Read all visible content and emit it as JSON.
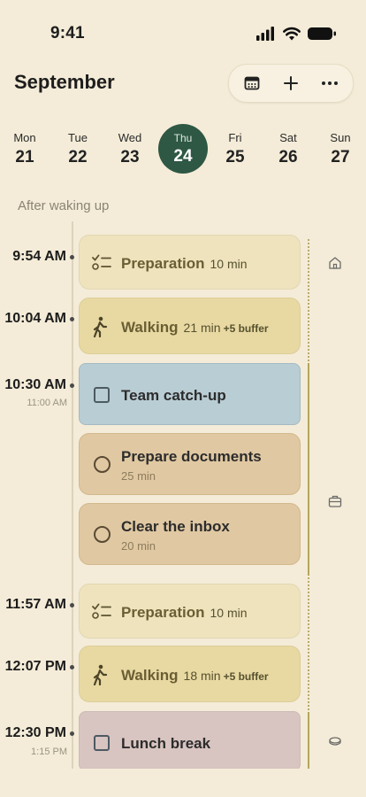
{
  "status_bar": {
    "time": "9:41",
    "icons": [
      "signal-icon",
      "wifi-icon",
      "battery-icon"
    ]
  },
  "header": {
    "month": "September",
    "actions": [
      {
        "name": "calendar-icon"
      },
      {
        "name": "add-icon"
      },
      {
        "name": "more-icon"
      }
    ]
  },
  "week": [
    {
      "dow": "Mon",
      "num": "21"
    },
    {
      "dow": "Tue",
      "num": "22"
    },
    {
      "dow": "Wed",
      "num": "23"
    },
    {
      "dow": "Thu",
      "num": "24",
      "selected": true
    },
    {
      "dow": "Fri",
      "num": "25"
    },
    {
      "dow": "Sat",
      "num": "26"
    },
    {
      "dow": "Sun",
      "num": "27"
    }
  ],
  "section_label": "After waking up",
  "timeline": {
    "times": [
      {
        "label": "9:54 AM"
      },
      {
        "label": "10:04 AM"
      },
      {
        "label": "10:30 AM",
        "sub": "11:00 AM"
      },
      {
        "label": "11:57 AM"
      },
      {
        "label": "12:07 PM"
      },
      {
        "label": "12:30 PM",
        "sub": "1:15 PM"
      }
    ],
    "items": [
      {
        "kind": "preparation",
        "title": "Preparation",
        "duration": "10 min"
      },
      {
        "kind": "walking",
        "title": "Walking",
        "duration": "21 min",
        "buffer": "+5 buffer"
      },
      {
        "kind": "event",
        "title": "Team catch-up"
      },
      {
        "kind": "task",
        "title": "Prepare documents",
        "duration": "25 min"
      },
      {
        "kind": "task",
        "title": "Clear the inbox",
        "duration": "20 min"
      },
      {
        "kind": "preparation",
        "title": "Preparation",
        "duration": "10 min"
      },
      {
        "kind": "walking",
        "title": "Walking",
        "duration": "18 min",
        "buffer": "+5 buffer"
      },
      {
        "kind": "event",
        "title": "Lunch break"
      }
    ],
    "side_icons": [
      "home-icon",
      "briefcase-icon",
      "food-icon"
    ]
  },
  "colors": {
    "background": "#f4ecd8",
    "selected_day": "#2e5744",
    "preparation": "#efe3bd",
    "walking": "#e8d9a2",
    "team_event": "#b9cdd4",
    "task": "#e0c8a2",
    "lunch": "#d8c4c0"
  }
}
